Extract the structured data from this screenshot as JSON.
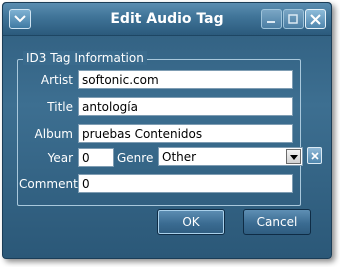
{
  "window": {
    "title": "Edit Audio Tag"
  },
  "group": {
    "legend": "ID3 Tag Information"
  },
  "fields": {
    "artist": {
      "label": "Artist",
      "value": "softonic.com"
    },
    "title": {
      "label": "Title",
      "value": "antología"
    },
    "album": {
      "label": "Album",
      "value": "pruebas Contenidos"
    },
    "year": {
      "label": "Year",
      "value": "0"
    },
    "genre": {
      "label": "Genre",
      "value": "Other"
    },
    "comment": {
      "label": "Comment",
      "value": "0"
    }
  },
  "buttons": {
    "ok": "OK",
    "cancel": "Cancel"
  },
  "icons": {
    "system_menu": "chevron-down-icon",
    "minimize": "minimize-icon",
    "maximize": "maximize-icon",
    "close": "close-icon",
    "genre_dropdown": "chevron-down-icon",
    "genre_clear": "close-icon"
  },
  "colors": {
    "window_bg": "#3d6f91",
    "title_text": "#ffffff",
    "field_bg": "#ffffff"
  }
}
